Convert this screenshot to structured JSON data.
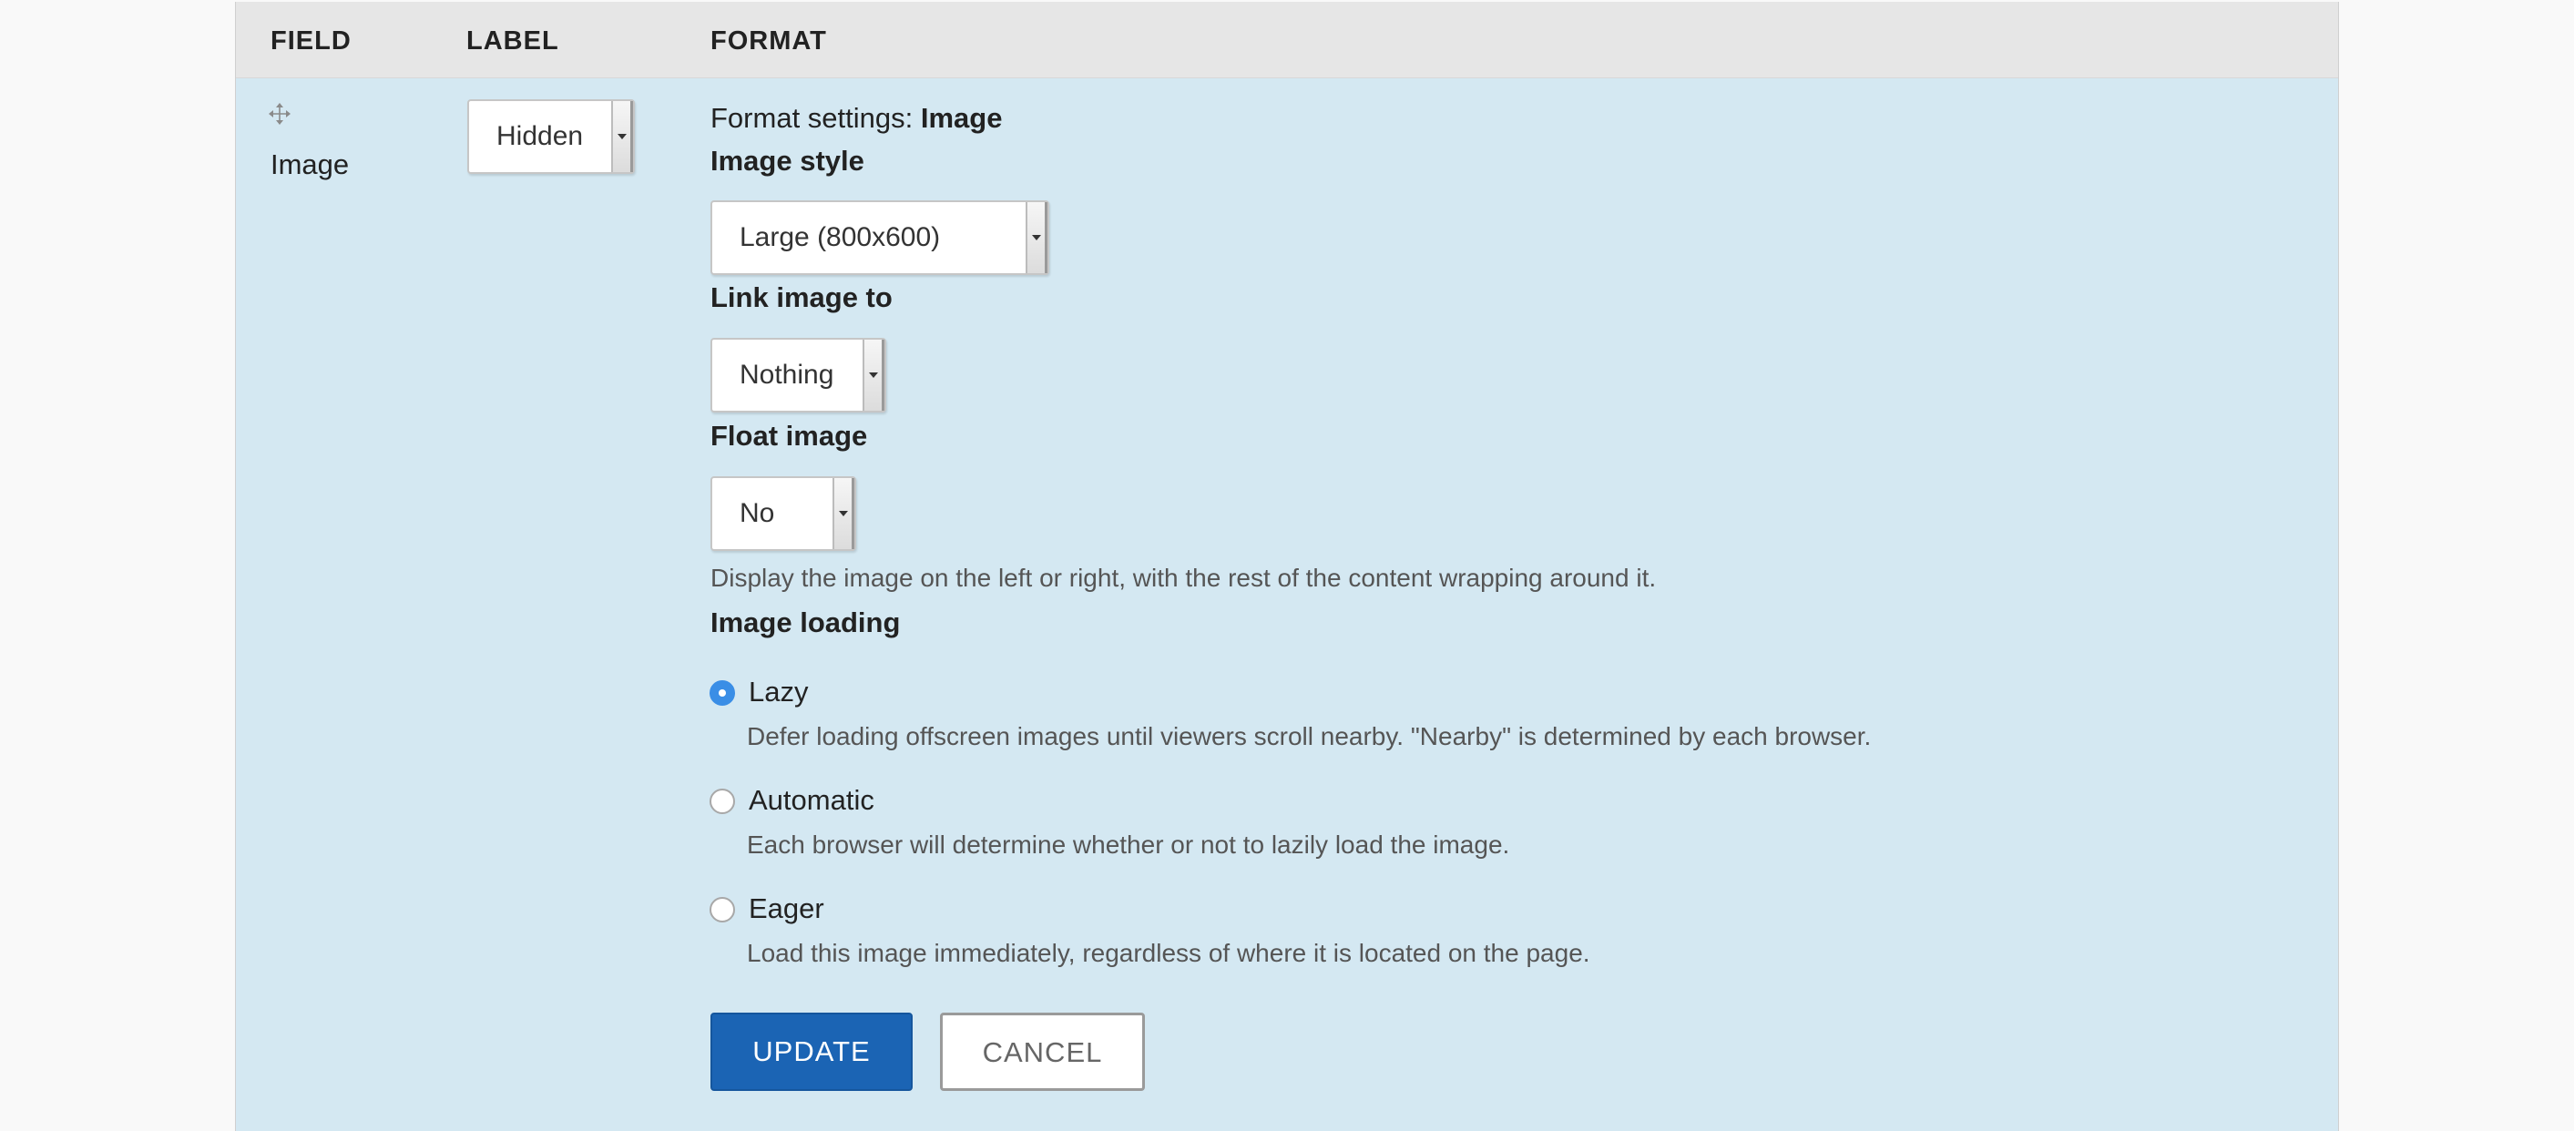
{
  "table": {
    "headers": {
      "field": "FIELD",
      "label": "LABEL",
      "format": "FORMAT"
    }
  },
  "row": {
    "field_name": "Image",
    "label_select": {
      "value": "Hidden"
    },
    "format_settings": {
      "prefix": "Format settings:",
      "formatter": "Image"
    },
    "image_style": {
      "label": "Image style",
      "value": "Large (800x600)"
    },
    "link_image_to": {
      "label": "Link image to",
      "value": "Nothing"
    },
    "float_image": {
      "label": "Float image",
      "value": "No",
      "description": "Display the image on the left or right, with the rest of the content wrapping around it."
    },
    "image_loading": {
      "label": "Image loading",
      "options": [
        {
          "label": "Lazy",
          "description": "Defer loading offscreen images until viewers scroll nearby. \"Nearby\" is determined by each browser.",
          "checked": true
        },
        {
          "label": "Automatic",
          "description": "Each browser will determine whether or not to lazily load the image.",
          "checked": false
        },
        {
          "label": "Eager",
          "description": "Load this image immediately, regardless of where it is located on the page.",
          "checked": false
        }
      ]
    },
    "actions": {
      "update_label": "UPDATE",
      "cancel_label": "CANCEL"
    }
  },
  "icons": {
    "drag_handle": "move-arrows-icon",
    "select_arrow": "caret-down-icon"
  },
  "colors": {
    "row_background": "#d4e8f2",
    "header_background": "#e6e6e6",
    "primary_button": "#1b64b4",
    "radio_checked": "#3a8ee6"
  }
}
